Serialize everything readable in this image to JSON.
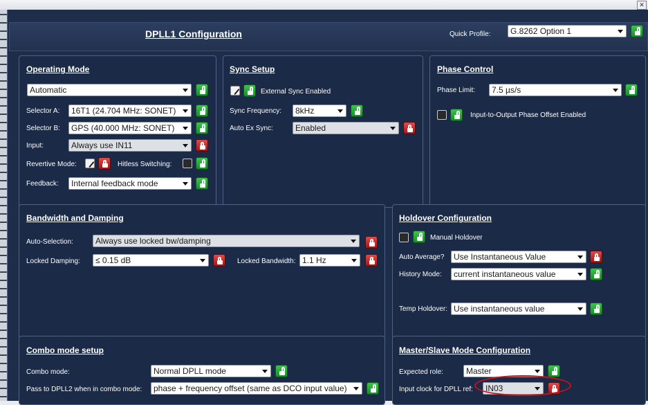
{
  "window": {
    "close_glyph": "✕"
  },
  "header": {
    "title": "DPLL1 Configuration",
    "quick_profile_label": "Quick Profile:",
    "quick_profile_value": "G.8262 Option 1"
  },
  "operating_mode": {
    "title": "Operating Mode",
    "mode_value": "Automatic",
    "selector_a_label": "Selector A:",
    "selector_a_value": "16T1 (24.704 MHz: SONET)",
    "selector_b_label": "Selector B:",
    "selector_b_value": "GPS (40.000 MHz: SONET)",
    "input_label": "Input:",
    "input_value": "Always use IN11",
    "revertive_label": "Revertive Mode:",
    "hitless_label": "Hitless Switching:",
    "feedback_label": "Feedback:",
    "feedback_value": "Internal feedback mode"
  },
  "sync_setup": {
    "title": "Sync Setup",
    "external_sync_label": "External Sync Enabled",
    "sync_frequency_label": "Sync Frequency:",
    "sync_frequency_value": "8kHz",
    "auto_ex_sync_label": "Auto Ex Sync:",
    "auto_ex_sync_value": "Enabled"
  },
  "phase_control": {
    "title": "Phase Control",
    "phase_limit_label": "Phase Limit:",
    "phase_limit_value": "7.5 µs/s",
    "offset_label": "Input-to-Output Phase Offset Enabled"
  },
  "bandwidth": {
    "title": "Bandwidth and Damping",
    "auto_selection_label": "Auto-Selection:",
    "auto_selection_value": "Always use locked bw/damping",
    "locked_damping_label": "Locked Damping:",
    "locked_damping_value": "≤ 0.15 dB",
    "locked_bandwidth_label": "Locked Bandwidth:",
    "locked_bandwidth_value": "1.1 Hz"
  },
  "holdover": {
    "title": "Holdover Configuration",
    "manual_label": "Manual Holdover",
    "auto_average_label": "Auto Average?",
    "auto_average_value": "Use Instantaneous Value",
    "history_label": "History Mode:",
    "history_value": "current instantaneous value",
    "temp_label": "Temp Holdover:",
    "temp_value": "Use instantaneous value"
  },
  "combo": {
    "title": "Combo mode setup",
    "mode_label": "Combo mode:",
    "mode_value": "Normal DPLL mode",
    "pass_label": "Pass to DPLL2 when in combo mode:",
    "pass_value": "phase + frequency offset (same as DCO input value)"
  },
  "master_slave": {
    "title": "Master/Slave Mode Configuration",
    "role_label": "Expected role:",
    "role_value": "Master",
    "input_clock_label": "Input clock for DPLL ref:",
    "input_clock_value": "IN03"
  },
  "colors": {
    "background": "#1e2d4a",
    "lock_open": "#1fa532",
    "lock_closed": "#c02020",
    "highlight": "#d0101a"
  }
}
